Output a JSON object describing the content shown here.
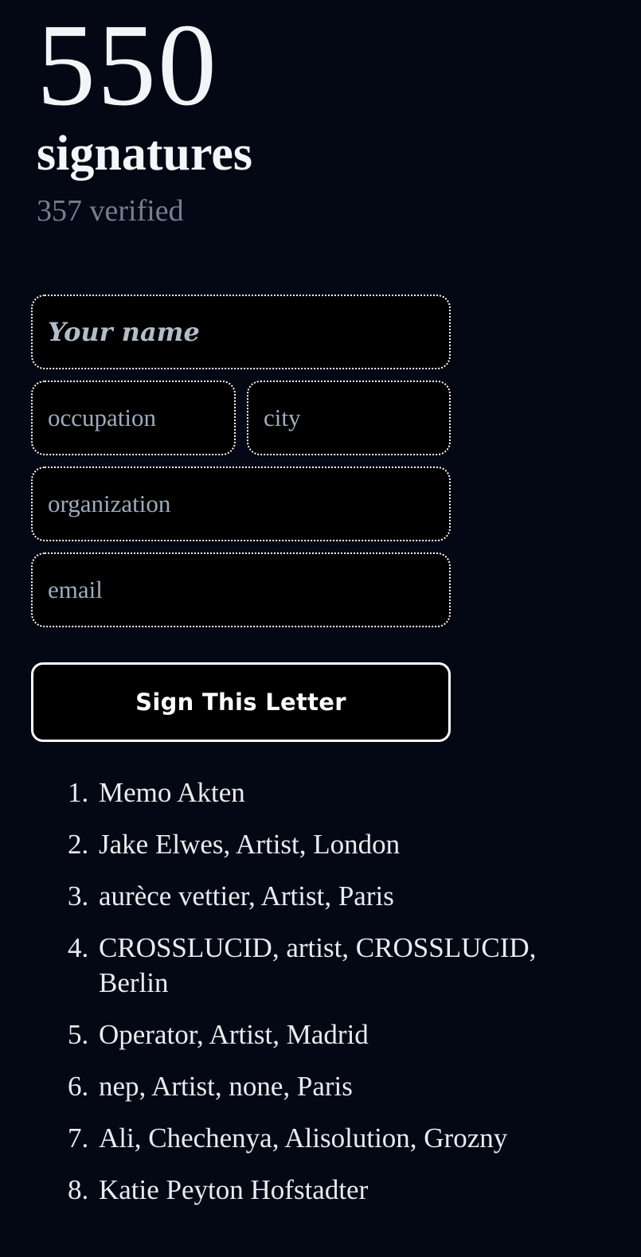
{
  "theme": {
    "background": "#030814",
    "field_background": "#000000",
    "field_border": "#ffffff",
    "text_primary": "#f2f4f8",
    "text_muted": "#767f90",
    "placeholder": "#9fabbd",
    "list_text": "#e8ebf1",
    "button_text": "#ffffff"
  },
  "header": {
    "count": "550",
    "count_label": "signatures",
    "verified": "357 verified"
  },
  "form": {
    "name_placeholder": "Your name",
    "name_value": "",
    "occupation_placeholder": "occupation",
    "occupation_value": "",
    "city_placeholder": "city",
    "city_value": "",
    "organization_placeholder": "organization",
    "organization_value": "",
    "email_placeholder": "email",
    "email_value": "",
    "submit_label": "Sign This Letter"
  },
  "signatures": [
    {
      "number": "1",
      "text": "Memo Akten"
    },
    {
      "number": "2",
      "text": "Jake Elwes, Artist, London"
    },
    {
      "number": "3",
      "text": "aurèce vettier, Artist, Paris"
    },
    {
      "number": "4",
      "text": "CROSSLUCID, artist, CROSSLUCID, Berlin"
    },
    {
      "number": "5",
      "text": "Operator, Artist, Madrid"
    },
    {
      "number": "6",
      "text": "nep, Artist, none, Paris"
    },
    {
      "number": "7",
      "text": "Ali, Chechenya, Alisolution, Grozny"
    },
    {
      "number": "8",
      "text": "Katie Peyton Hofstadter"
    }
  ]
}
